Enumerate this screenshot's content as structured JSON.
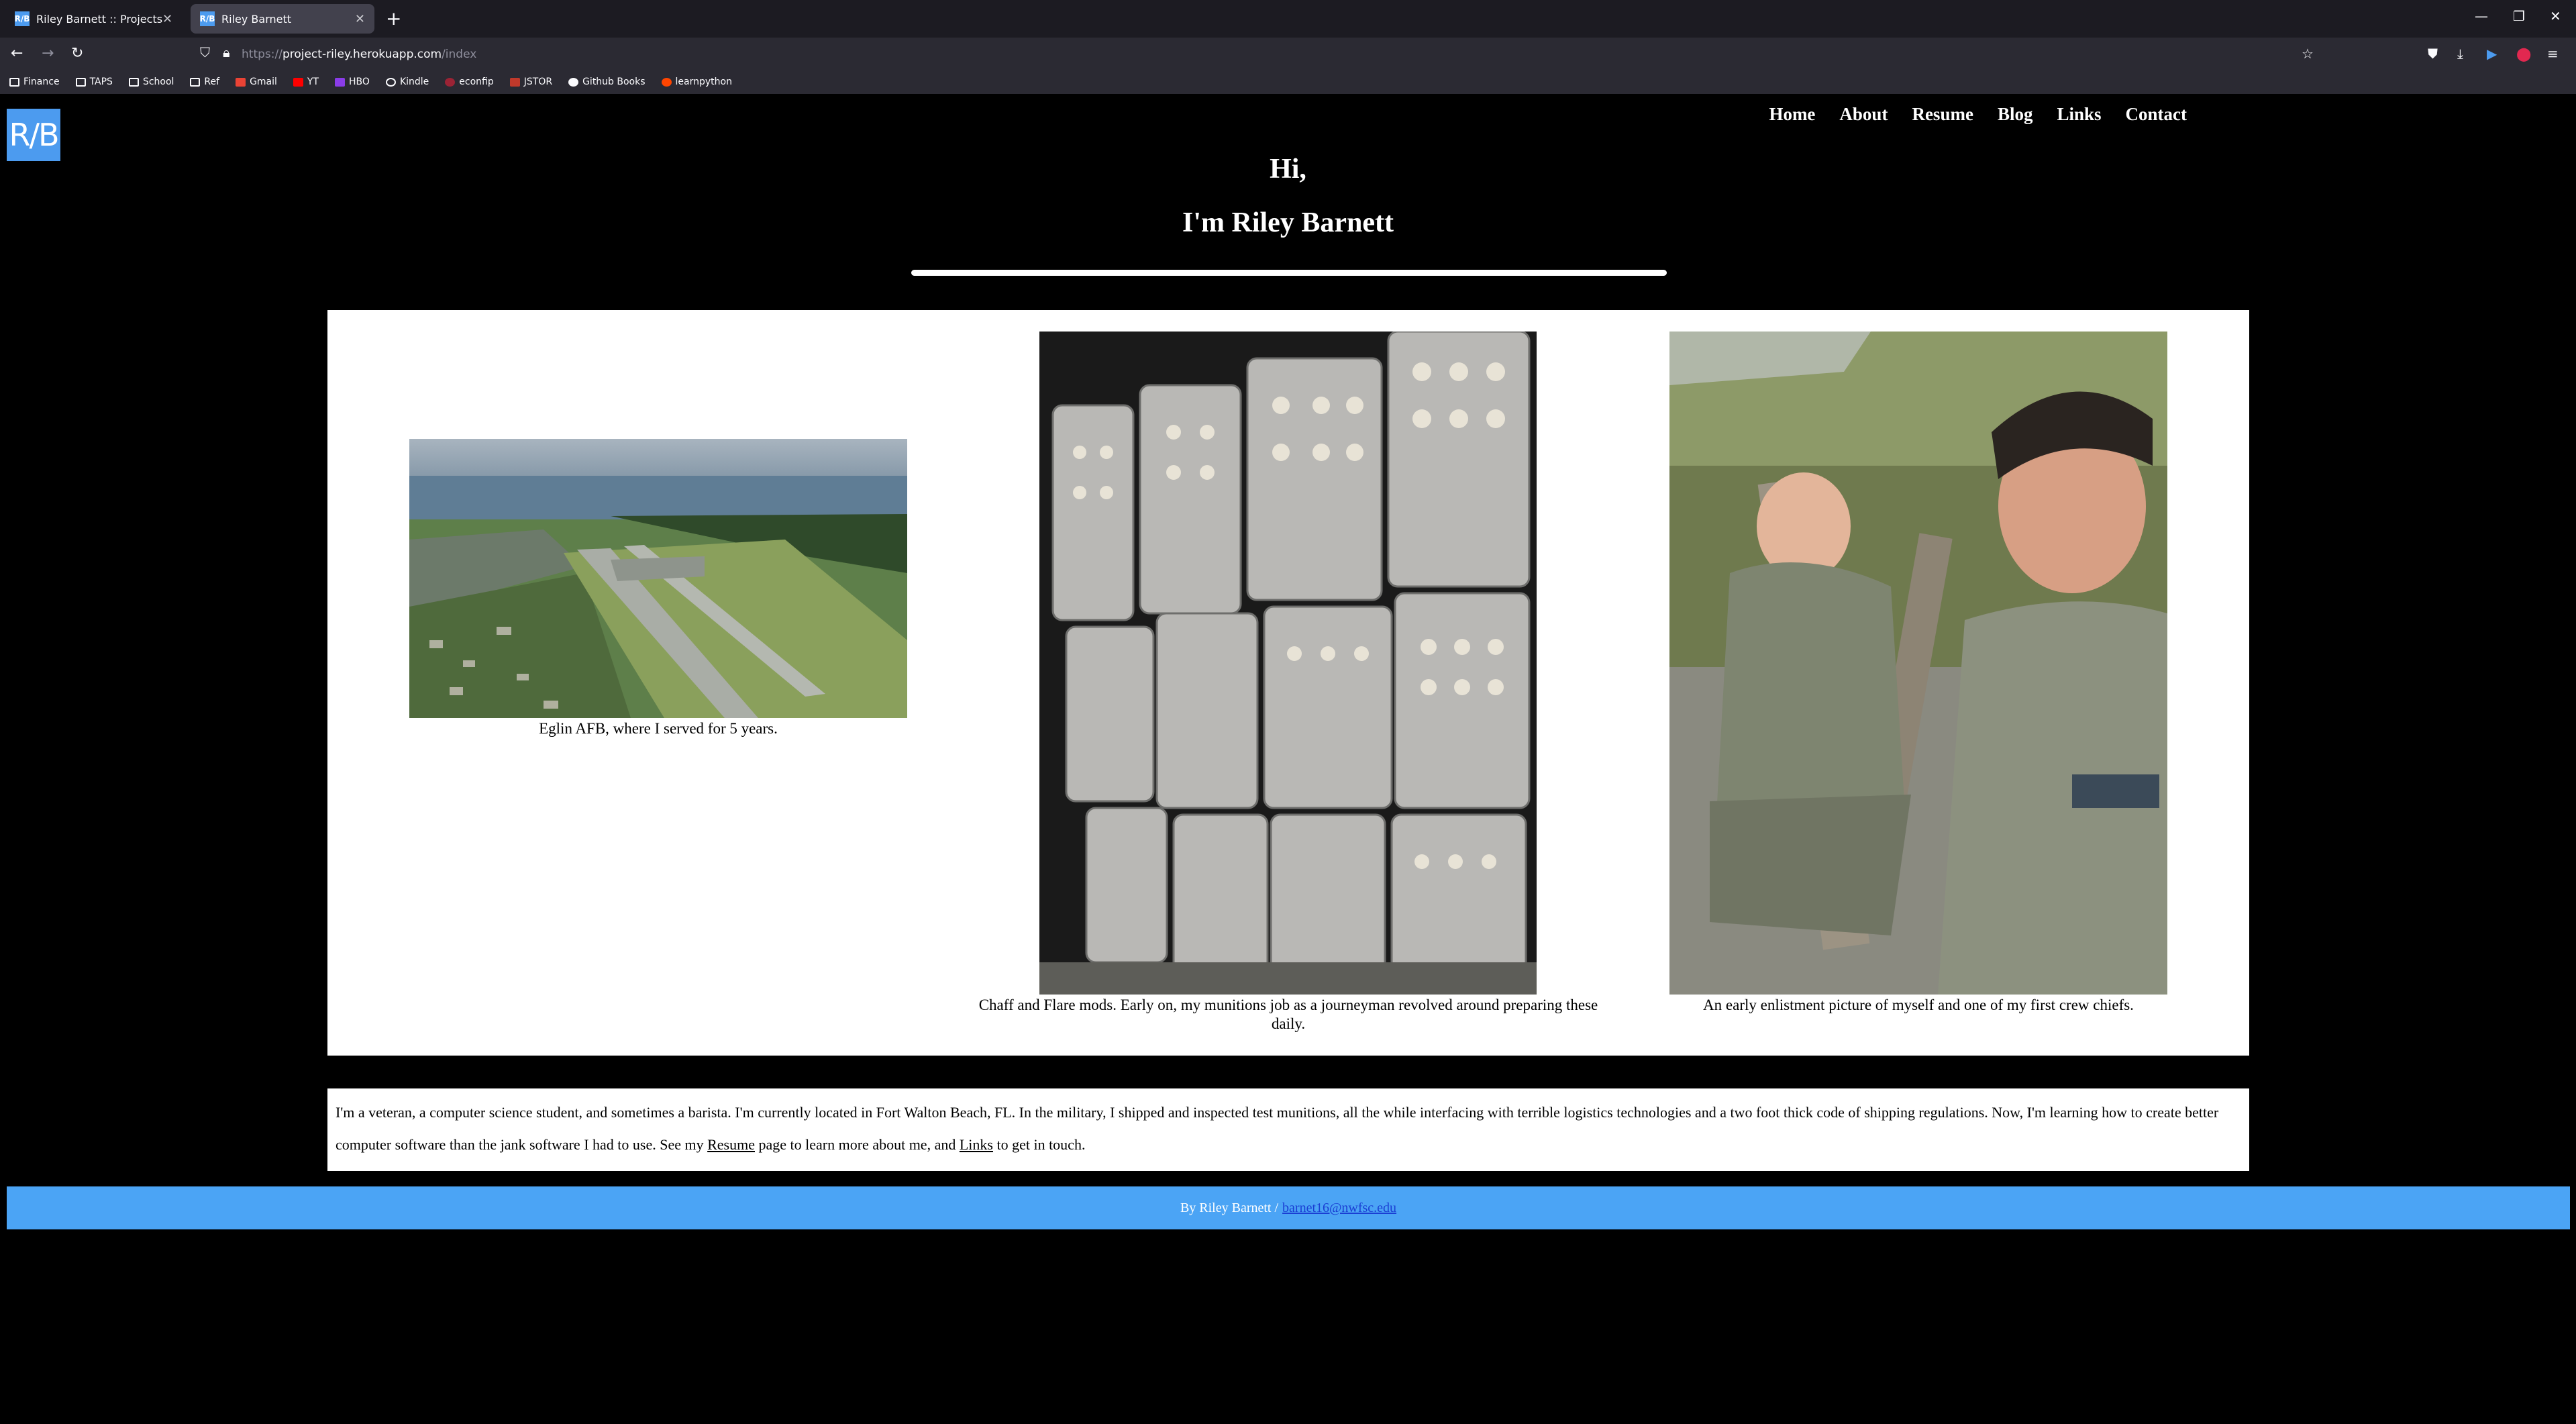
{
  "browser": {
    "tabs": [
      {
        "title": "Riley Barnett :: Projects",
        "favicon": "R/B"
      },
      {
        "title": "Riley Barnett",
        "favicon": "R/B"
      }
    ],
    "new_tab": "+",
    "url_scheme": "https://",
    "url_host": "project-riley.herokuapp.com",
    "url_path": "/index",
    "bookmarks": [
      {
        "label": "Finance",
        "icon": "folder-icon"
      },
      {
        "label": "TAPS",
        "icon": "folder-icon"
      },
      {
        "label": "School",
        "icon": "folder-icon"
      },
      {
        "label": "Ref",
        "icon": "folder-icon"
      },
      {
        "label": "Gmail",
        "icon": "gmail-icon"
      },
      {
        "label": "YT",
        "icon": "youtube-icon"
      },
      {
        "label": "HBO",
        "icon": "hbo-icon"
      },
      {
        "label": "Kindle",
        "icon": "globe-icon"
      },
      {
        "label": "econfip",
        "icon": "site-icon"
      },
      {
        "label": "JSTOR",
        "icon": "jstor-icon"
      },
      {
        "label": "Github Books",
        "icon": "github-icon"
      },
      {
        "label": "learnpython",
        "icon": "reddit-icon"
      }
    ]
  },
  "site": {
    "logo": "R/B",
    "nav": [
      "Home",
      "About",
      "Resume",
      "Blog",
      "Links",
      "Contact"
    ],
    "greeting": "Hi,",
    "name_line": "I'm Riley Barnett",
    "gallery": [
      {
        "caption": "Eglin AFB, where I served for 5 years."
      },
      {
        "caption": "Chaff and Flare mods. Early on, my munitions job as a journeyman revolved around preparing these daily."
      },
      {
        "caption": "An early enlistment picture of myself and one of my first crew chiefs."
      }
    ],
    "about": {
      "text_before": "I'm a veteran, a computer science student, and sometimes a barista. I'm currently located in Fort Walton Beach, FL. In the military, I shipped and inspected test munitions, all the while interfacing with terrible logistics technologies and a two foot thick code of shipping regulations. Now, I'm learning how to create better computer software than the jank software I had to use. See my ",
      "resume_link": "Resume",
      "text_middle": " page to learn more about me, and ",
      "links_link": "Links",
      "text_after": " to get in touch."
    },
    "footer": {
      "text": "By Riley Barnett /",
      "email": "barnet16@nwfsc.edu"
    }
  },
  "colors": {
    "accent": "#4c9bef",
    "footer_bg": "#4ba4f5",
    "page_bg": "#000000"
  }
}
